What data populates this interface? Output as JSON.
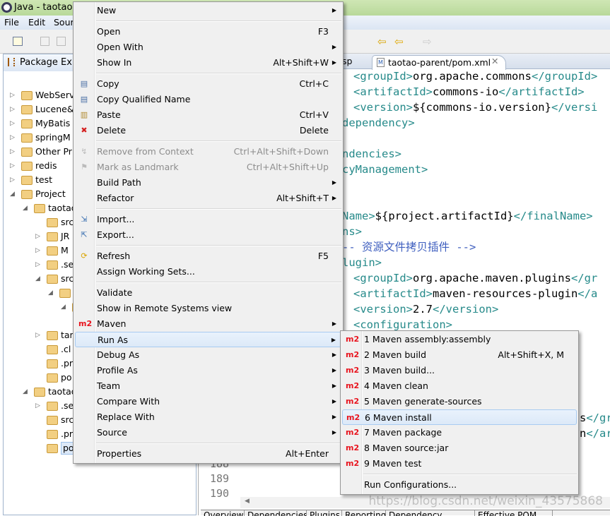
{
  "window": {
    "title": "Java - taotao-"
  },
  "menubar": [
    "File",
    "Edit",
    "Sour"
  ],
  "left_panel": {
    "title": "Package Exp",
    "items": [
      {
        "label": "WebServ",
        "depth": 0,
        "tw": "▷"
      },
      {
        "label": "Lucene&",
        "depth": 0,
        "tw": "▷"
      },
      {
        "label": "MyBatis",
        "depth": 0,
        "tw": "▷"
      },
      {
        "label": "springM",
        "depth": 0,
        "tw": "▷"
      },
      {
        "label": "Other Pr",
        "depth": 0,
        "tw": "▷"
      },
      {
        "label": "redis",
        "depth": 0,
        "tw": "▷"
      },
      {
        "label": "test",
        "depth": 0,
        "tw": "▷"
      },
      {
        "label": "Project",
        "depth": 0,
        "tw": "◢"
      },
      {
        "label": "taotao",
        "depth": 1,
        "tw": "◢"
      },
      {
        "label": "src",
        "depth": 2,
        "tw": ""
      },
      {
        "label": "JR",
        "depth": 2,
        "tw": "▷"
      },
      {
        "label": "M",
        "depth": 2,
        "tw": "▷"
      },
      {
        "label": ".se",
        "depth": 2,
        "tw": "▷"
      },
      {
        "label": "src",
        "depth": 2,
        "tw": "◢"
      },
      {
        "label": "",
        "depth": 3,
        "tw": "◢"
      },
      {
        "label": "",
        "depth": 4,
        "tw": "◢"
      },
      {
        "label": "",
        "depth": 5,
        "tw": ""
      },
      {
        "label": "tar",
        "depth": 2,
        "tw": "▷"
      },
      {
        "label": ".cl",
        "depth": 2,
        "tw": ""
      },
      {
        "label": ".pr",
        "depth": 2,
        "tw": ""
      },
      {
        "label": "po",
        "depth": 2,
        "tw": ""
      },
      {
        "label": "taotao",
        "depth": 1,
        "tw": "◢"
      },
      {
        "label": ".se",
        "depth": 2,
        "tw": "▷"
      },
      {
        "label": "src",
        "depth": 2,
        "tw": ""
      },
      {
        "label": ".pr",
        "depth": 2,
        "tw": ""
      },
      {
        "label": "pom.xml",
        "depth": 2,
        "tw": "",
        "selected": true
      }
    ]
  },
  "editor": {
    "tabs": [
      {
        "label": "sp"
      },
      {
        "label": "taotao-parent/pom.xml",
        "active": true
      }
    ],
    "lines": [
      {
        "t": "<groupId>",
        "v": "org.apache.commons",
        "e": "</groupId>"
      },
      {
        "t": "<artifactId>",
        "v": "commons-io",
        "e": "</artifactId>"
      },
      {
        "t": "<version>",
        "v": "${commons-io.version}",
        "e": "</versi"
      },
      {
        "t": "",
        "v": "",
        "e": "dependency>"
      },
      {
        "t": "",
        "v": "",
        "e": ""
      },
      {
        "t": "",
        "v": "",
        "e": "ndencies>"
      },
      {
        "t": "",
        "v": "",
        "e": "cyManagement>"
      },
      {
        "t": "",
        "v": "",
        "e": ""
      },
      {
        "t": "",
        "v": "",
        "e": ""
      },
      {
        "t": "Name>",
        "v": "${project.artifactId}",
        "e": "</finalName>"
      },
      {
        "t": "",
        "v": "",
        "e": "ns>"
      },
      {
        "c": "-- 资源文件拷贝插件 -->"
      },
      {
        "t": "",
        "v": "",
        "e": "lugin>"
      },
      {
        "t": "<groupId>",
        "v": "org.apache.maven.plugins",
        "e": "</gr"
      },
      {
        "t": "<artifactId>",
        "v": "maven-resources-plugin",
        "e": "</a"
      },
      {
        "t": "<version>",
        "v": "2.7",
        "e": "</version>"
      },
      {
        "t": "<configuration>",
        "v": "",
        "e": ""
      }
    ],
    "partial_lines": [
      {
        "v": "s",
        "e": "</gr"
      },
      {
        "v": "n",
        "e": "</ar"
      }
    ],
    "line_numbers": [
      "188",
      "189",
      "190"
    ],
    "bottom_tabs": [
      "Overview",
      "Dependencies",
      "Plugins",
      "Reporting",
      "Dependency Hierarchy",
      "Effective POM"
    ]
  },
  "context_menu": [
    {
      "label": "New",
      "arrow": true
    },
    {
      "sep": true
    },
    {
      "label": "Open",
      "shortcut": "F3"
    },
    {
      "label": "Open With",
      "arrow": true
    },
    {
      "label": "Show In",
      "shortcut": "Alt+Shift+W",
      "arrow": true
    },
    {
      "sep": true
    },
    {
      "label": "Copy",
      "shortcut": "Ctrl+C",
      "icon": "copy-icon"
    },
    {
      "label": "Copy Qualified Name",
      "icon": "copy-qualified-icon"
    },
    {
      "label": "Paste",
      "shortcut": "Ctrl+V",
      "icon": "paste-icon"
    },
    {
      "label": "Delete",
      "shortcut": "Delete",
      "icon": "delete-icon"
    },
    {
      "sep": true
    },
    {
      "label": "Remove from Context",
      "shortcut": "Ctrl+Alt+Shift+Down",
      "disabled": true,
      "icon": "remove-context-icon"
    },
    {
      "label": "Mark as Landmark",
      "shortcut": "Ctrl+Alt+Shift+Up",
      "disabled": true,
      "icon": "landmark-icon"
    },
    {
      "label": "Build Path",
      "arrow": true
    },
    {
      "label": "Refactor",
      "shortcut": "Alt+Shift+T",
      "arrow": true
    },
    {
      "sep": true
    },
    {
      "label": "Import...",
      "icon": "import-icon"
    },
    {
      "label": "Export...",
      "icon": "export-icon"
    },
    {
      "sep": true
    },
    {
      "label": "Refresh",
      "shortcut": "F5",
      "icon": "refresh-icon"
    },
    {
      "label": "Assign Working Sets..."
    },
    {
      "sep": true
    },
    {
      "label": "Validate"
    },
    {
      "label": "Show in Remote Systems view"
    },
    {
      "label": "Maven",
      "arrow": true,
      "icon": "m2-icon"
    },
    {
      "label": "Run As",
      "arrow": true,
      "highlighted": true
    },
    {
      "label": "Debug As",
      "arrow": true
    },
    {
      "label": "Profile As",
      "arrow": true
    },
    {
      "label": "Team",
      "arrow": true
    },
    {
      "label": "Compare With",
      "arrow": true
    },
    {
      "label": "Replace With",
      "arrow": true
    },
    {
      "label": "Source",
      "arrow": true
    },
    {
      "sep": true
    },
    {
      "label": "Properties",
      "shortcut": "Alt+Enter"
    }
  ],
  "run_as_menu": [
    {
      "label": "1 Maven assembly:assembly",
      "icon": "m2-icon"
    },
    {
      "label": "2 Maven build",
      "shortcut": "Alt+Shift+X, M",
      "icon": "m2-icon"
    },
    {
      "label": "3 Maven build...",
      "icon": "m2-icon"
    },
    {
      "label": "4 Maven clean",
      "icon": "m2-icon"
    },
    {
      "label": "5 Maven generate-sources",
      "icon": "m2-icon"
    },
    {
      "label": "6 Maven install",
      "icon": "m2-icon",
      "highlighted": true
    },
    {
      "label": "7 Maven package",
      "icon": "m2-icon"
    },
    {
      "label": "8 Maven source:jar",
      "icon": "m2-icon"
    },
    {
      "label": "9 Maven test",
      "icon": "m2-icon"
    },
    {
      "sep": true
    },
    {
      "label": "Run Configurations..."
    }
  ],
  "m2_icon_text": "m2",
  "watermark": "https://blog.csdn.net/weixin_43575868"
}
